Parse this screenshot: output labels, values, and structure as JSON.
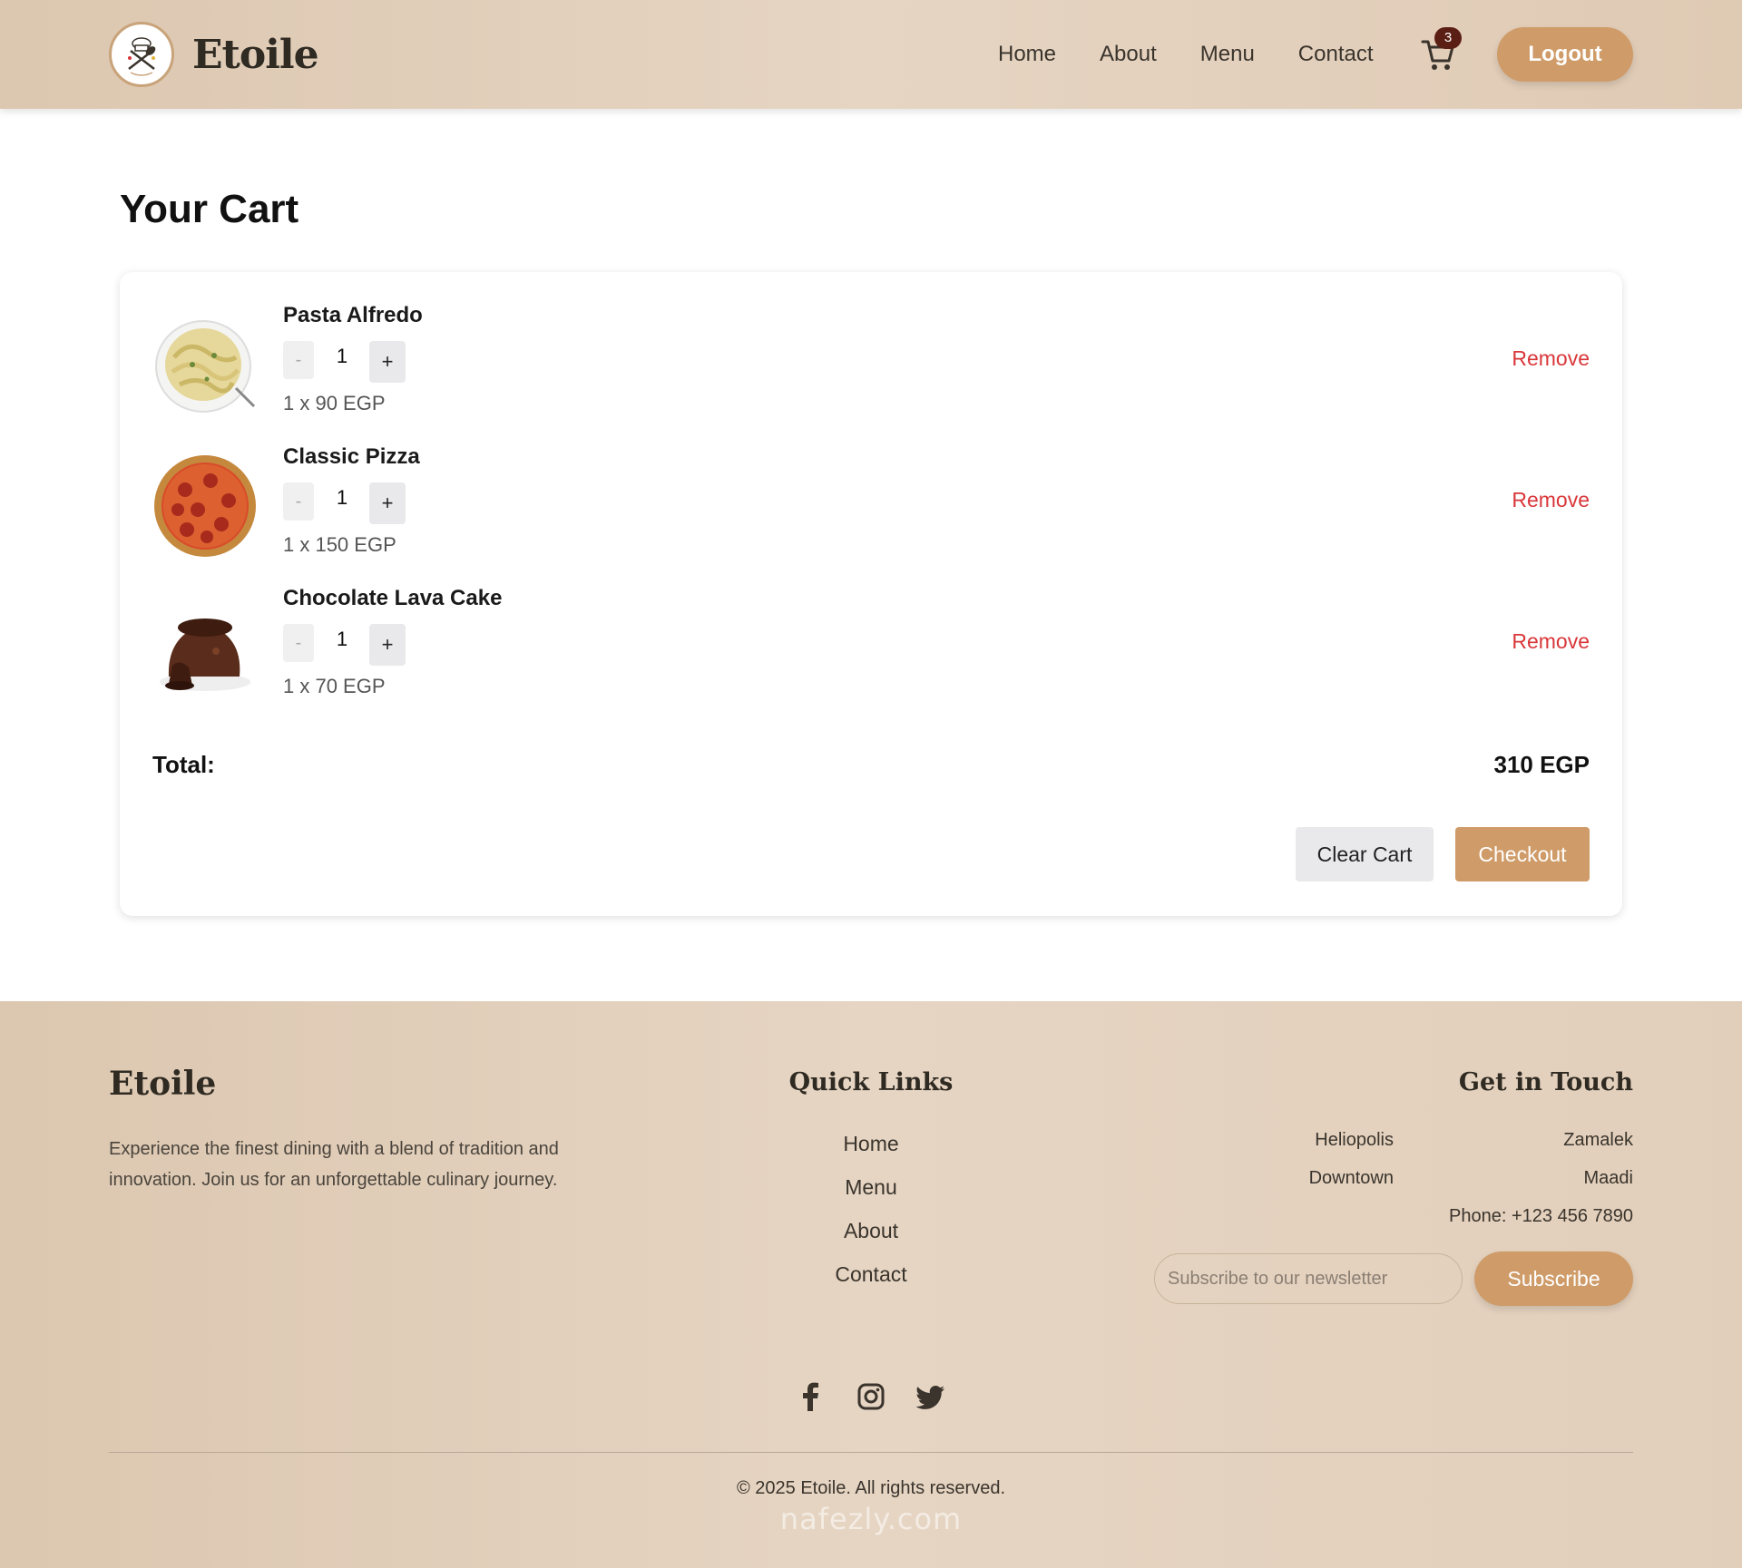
{
  "header": {
    "brand": "Etoile",
    "nav": [
      "Home",
      "About",
      "Menu",
      "Contact"
    ],
    "cart_count": "3",
    "logout_label": "Logout"
  },
  "cart": {
    "title": "Your Cart",
    "items": [
      {
        "name": "Pasta Alfredo",
        "quantity": "1",
        "price_line": "1 x 90 EGP",
        "remove_label": "Remove",
        "minus_label": "-",
        "plus_label": "+"
      },
      {
        "name": "Classic Pizza",
        "quantity": "1",
        "price_line": "1 x 150 EGP",
        "remove_label": "Remove",
        "minus_label": "-",
        "plus_label": "+"
      },
      {
        "name": "Chocolate Lava Cake",
        "quantity": "1",
        "price_line": "1 x 70 EGP",
        "remove_label": "Remove",
        "minus_label": "-",
        "plus_label": "+"
      }
    ],
    "total_label": "Total:",
    "total_value": "310 EGP",
    "clear_label": "Clear Cart",
    "checkout_label": "Checkout"
  },
  "footer": {
    "brand": "Etoile",
    "description": "Experience the finest dining with a blend of tradition and innovation. Join us for an unforgettable culinary journey.",
    "quick_links_title": "Quick Links",
    "quick_links": [
      "Home",
      "Menu",
      "About",
      "Contact"
    ],
    "get_in_touch_title": "Get in Touch",
    "locations": [
      "Heliopolis",
      "Zamalek",
      "Downtown",
      "Maadi"
    ],
    "phone": "Phone: +123 456 7890",
    "newsletter_placeholder": "Subscribe to our newsletter",
    "subscribe_label": "Subscribe",
    "social_icons": [
      "facebook-icon",
      "instagram-icon",
      "twitter-icon"
    ],
    "copyright": "© 2025 Etoile. All rights reserved.",
    "watermark": "nafezly.com"
  },
  "colors": {
    "accent": "#cf9b68",
    "danger": "#d9373a",
    "header_bg": "#dcc7b0",
    "badge": "#5b1e14"
  }
}
